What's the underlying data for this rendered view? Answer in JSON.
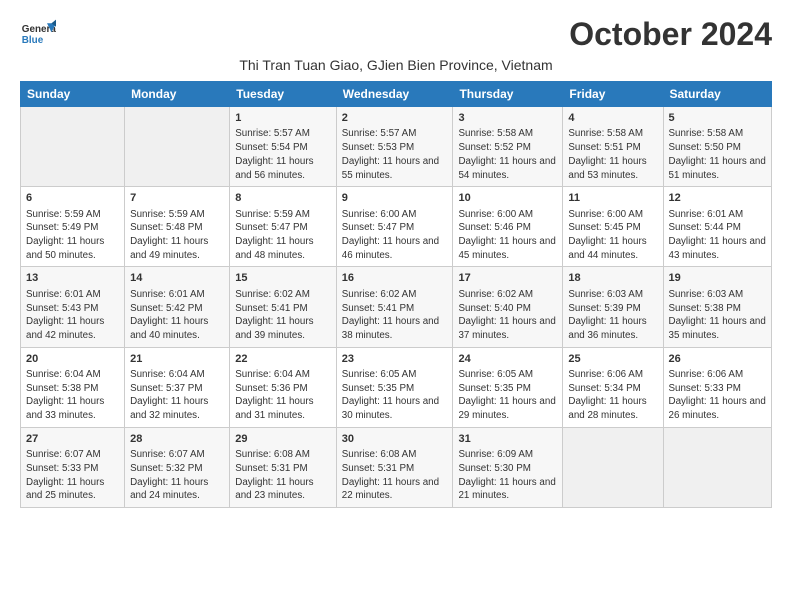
{
  "logo": {
    "line1": "General",
    "line2": "Blue"
  },
  "title": "October 2024",
  "subtitle": "Thi Tran Tuan Giao, GJien Bien Province, Vietnam",
  "days_header": [
    "Sunday",
    "Monday",
    "Tuesday",
    "Wednesday",
    "Thursday",
    "Friday",
    "Saturday"
  ],
  "weeks": [
    [
      {
        "day": "",
        "info": ""
      },
      {
        "day": "",
        "info": ""
      },
      {
        "day": "1",
        "info": "Sunrise: 5:57 AM\nSunset: 5:54 PM\nDaylight: 11 hours and 56 minutes."
      },
      {
        "day": "2",
        "info": "Sunrise: 5:57 AM\nSunset: 5:53 PM\nDaylight: 11 hours and 55 minutes."
      },
      {
        "day": "3",
        "info": "Sunrise: 5:58 AM\nSunset: 5:52 PM\nDaylight: 11 hours and 54 minutes."
      },
      {
        "day": "4",
        "info": "Sunrise: 5:58 AM\nSunset: 5:51 PM\nDaylight: 11 hours and 53 minutes."
      },
      {
        "day": "5",
        "info": "Sunrise: 5:58 AM\nSunset: 5:50 PM\nDaylight: 11 hours and 51 minutes."
      }
    ],
    [
      {
        "day": "6",
        "info": "Sunrise: 5:59 AM\nSunset: 5:49 PM\nDaylight: 11 hours and 50 minutes."
      },
      {
        "day": "7",
        "info": "Sunrise: 5:59 AM\nSunset: 5:48 PM\nDaylight: 11 hours and 49 minutes."
      },
      {
        "day": "8",
        "info": "Sunrise: 5:59 AM\nSunset: 5:47 PM\nDaylight: 11 hours and 48 minutes."
      },
      {
        "day": "9",
        "info": "Sunrise: 6:00 AM\nSunset: 5:47 PM\nDaylight: 11 hours and 46 minutes."
      },
      {
        "day": "10",
        "info": "Sunrise: 6:00 AM\nSunset: 5:46 PM\nDaylight: 11 hours and 45 minutes."
      },
      {
        "day": "11",
        "info": "Sunrise: 6:00 AM\nSunset: 5:45 PM\nDaylight: 11 hours and 44 minutes."
      },
      {
        "day": "12",
        "info": "Sunrise: 6:01 AM\nSunset: 5:44 PM\nDaylight: 11 hours and 43 minutes."
      }
    ],
    [
      {
        "day": "13",
        "info": "Sunrise: 6:01 AM\nSunset: 5:43 PM\nDaylight: 11 hours and 42 minutes."
      },
      {
        "day": "14",
        "info": "Sunrise: 6:01 AM\nSunset: 5:42 PM\nDaylight: 11 hours and 40 minutes."
      },
      {
        "day": "15",
        "info": "Sunrise: 6:02 AM\nSunset: 5:41 PM\nDaylight: 11 hours and 39 minutes."
      },
      {
        "day": "16",
        "info": "Sunrise: 6:02 AM\nSunset: 5:41 PM\nDaylight: 11 hours and 38 minutes."
      },
      {
        "day": "17",
        "info": "Sunrise: 6:02 AM\nSunset: 5:40 PM\nDaylight: 11 hours and 37 minutes."
      },
      {
        "day": "18",
        "info": "Sunrise: 6:03 AM\nSunset: 5:39 PM\nDaylight: 11 hours and 36 minutes."
      },
      {
        "day": "19",
        "info": "Sunrise: 6:03 AM\nSunset: 5:38 PM\nDaylight: 11 hours and 35 minutes."
      }
    ],
    [
      {
        "day": "20",
        "info": "Sunrise: 6:04 AM\nSunset: 5:38 PM\nDaylight: 11 hours and 33 minutes."
      },
      {
        "day": "21",
        "info": "Sunrise: 6:04 AM\nSunset: 5:37 PM\nDaylight: 11 hours and 32 minutes."
      },
      {
        "day": "22",
        "info": "Sunrise: 6:04 AM\nSunset: 5:36 PM\nDaylight: 11 hours and 31 minutes."
      },
      {
        "day": "23",
        "info": "Sunrise: 6:05 AM\nSunset: 5:35 PM\nDaylight: 11 hours and 30 minutes."
      },
      {
        "day": "24",
        "info": "Sunrise: 6:05 AM\nSunset: 5:35 PM\nDaylight: 11 hours and 29 minutes."
      },
      {
        "day": "25",
        "info": "Sunrise: 6:06 AM\nSunset: 5:34 PM\nDaylight: 11 hours and 28 minutes."
      },
      {
        "day": "26",
        "info": "Sunrise: 6:06 AM\nSunset: 5:33 PM\nDaylight: 11 hours and 26 minutes."
      }
    ],
    [
      {
        "day": "27",
        "info": "Sunrise: 6:07 AM\nSunset: 5:33 PM\nDaylight: 11 hours and 25 minutes."
      },
      {
        "day": "28",
        "info": "Sunrise: 6:07 AM\nSunset: 5:32 PM\nDaylight: 11 hours and 24 minutes."
      },
      {
        "day": "29",
        "info": "Sunrise: 6:08 AM\nSunset: 5:31 PM\nDaylight: 11 hours and 23 minutes."
      },
      {
        "day": "30",
        "info": "Sunrise: 6:08 AM\nSunset: 5:31 PM\nDaylight: 11 hours and 22 minutes."
      },
      {
        "day": "31",
        "info": "Sunrise: 6:09 AM\nSunset: 5:30 PM\nDaylight: 11 hours and 21 minutes."
      },
      {
        "day": "",
        "info": ""
      },
      {
        "day": "",
        "info": ""
      }
    ]
  ]
}
